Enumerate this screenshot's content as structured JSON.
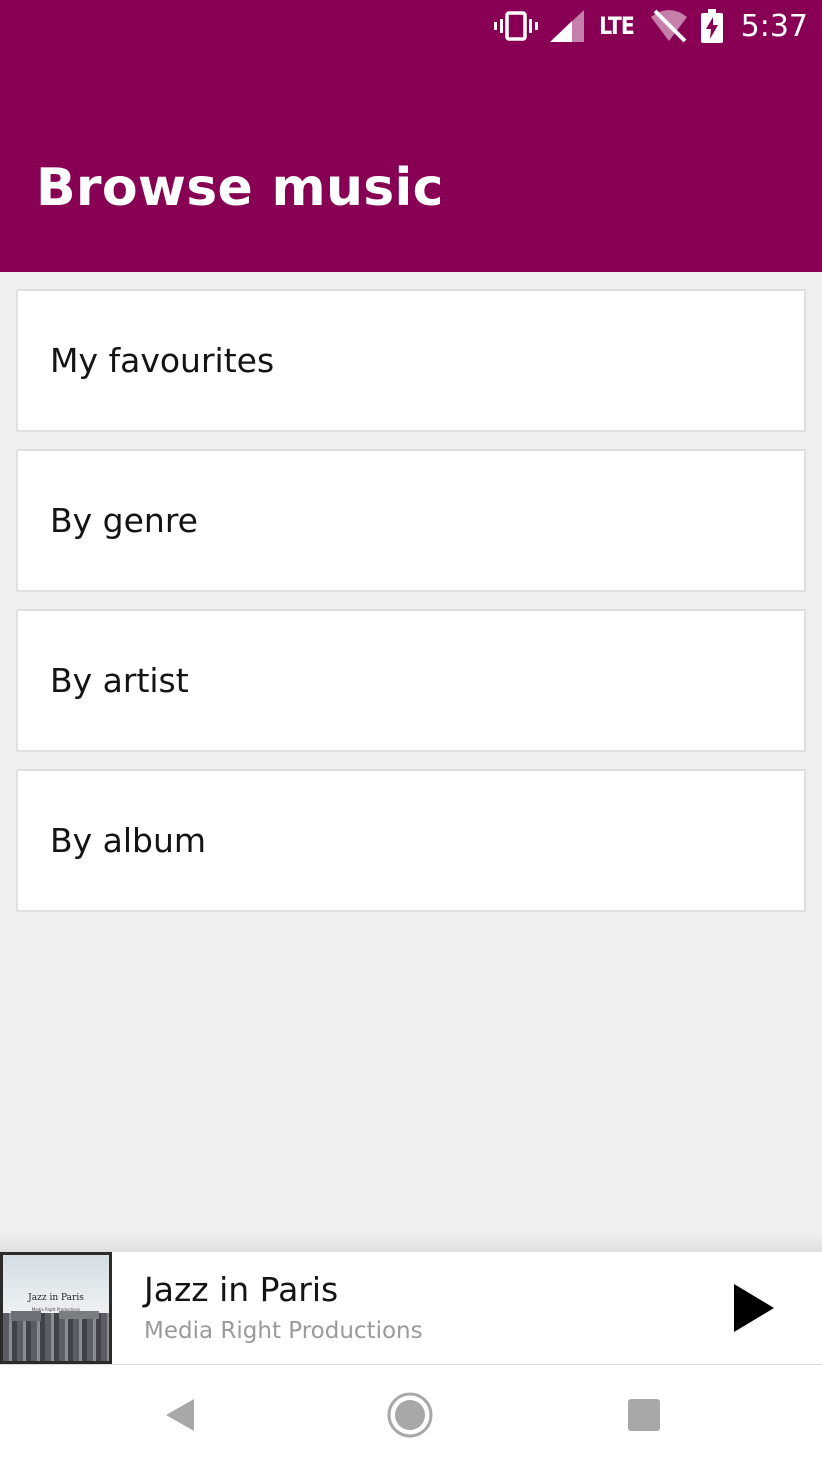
{
  "status_bar": {
    "network_label": "LTE",
    "time": "5:37",
    "icons": [
      "vibrate-icon",
      "cellular-signal-icon",
      "wifi-off-icon",
      "battery-charging-icon"
    ]
  },
  "header": {
    "title": "Browse music"
  },
  "menu": {
    "items": [
      {
        "label": "My favourites"
      },
      {
        "label": "By genre"
      },
      {
        "label": "By artist"
      },
      {
        "label": "By album"
      }
    ]
  },
  "player": {
    "track_title": "Jazz in Paris",
    "artist": "Media Right Productions",
    "album_art_title": "Jazz in Paris",
    "album_art_subtitle": "Media Right Productions",
    "play_icon": "play-icon"
  },
  "navigation": {
    "icons": [
      "back-icon",
      "home-icon",
      "recents-icon"
    ]
  },
  "colors": {
    "app_bar": "#880054",
    "background": "#efefef",
    "card": "#ffffff",
    "secondary_text": "#9a9a9a"
  }
}
